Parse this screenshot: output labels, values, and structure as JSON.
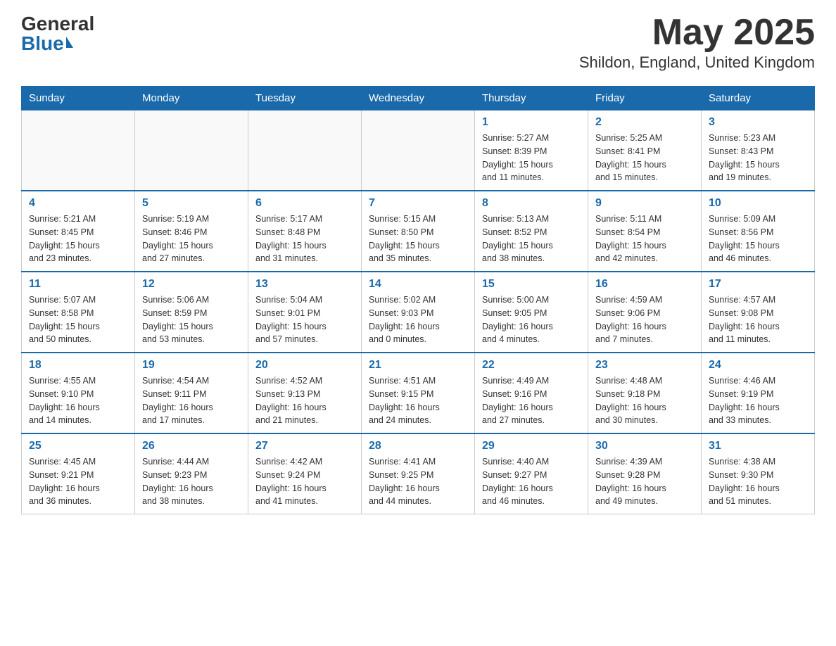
{
  "header": {
    "logo_general": "General",
    "logo_blue": "Blue",
    "month_title": "May 2025",
    "location": "Shildon, England, United Kingdom"
  },
  "days_of_week": [
    "Sunday",
    "Monday",
    "Tuesday",
    "Wednesday",
    "Thursday",
    "Friday",
    "Saturday"
  ],
  "weeks": [
    [
      {
        "day": "",
        "info": ""
      },
      {
        "day": "",
        "info": ""
      },
      {
        "day": "",
        "info": ""
      },
      {
        "day": "",
        "info": ""
      },
      {
        "day": "1",
        "info": "Sunrise: 5:27 AM\nSunset: 8:39 PM\nDaylight: 15 hours\nand 11 minutes."
      },
      {
        "day": "2",
        "info": "Sunrise: 5:25 AM\nSunset: 8:41 PM\nDaylight: 15 hours\nand 15 minutes."
      },
      {
        "day": "3",
        "info": "Sunrise: 5:23 AM\nSunset: 8:43 PM\nDaylight: 15 hours\nand 19 minutes."
      }
    ],
    [
      {
        "day": "4",
        "info": "Sunrise: 5:21 AM\nSunset: 8:45 PM\nDaylight: 15 hours\nand 23 minutes."
      },
      {
        "day": "5",
        "info": "Sunrise: 5:19 AM\nSunset: 8:46 PM\nDaylight: 15 hours\nand 27 minutes."
      },
      {
        "day": "6",
        "info": "Sunrise: 5:17 AM\nSunset: 8:48 PM\nDaylight: 15 hours\nand 31 minutes."
      },
      {
        "day": "7",
        "info": "Sunrise: 5:15 AM\nSunset: 8:50 PM\nDaylight: 15 hours\nand 35 minutes."
      },
      {
        "day": "8",
        "info": "Sunrise: 5:13 AM\nSunset: 8:52 PM\nDaylight: 15 hours\nand 38 minutes."
      },
      {
        "day": "9",
        "info": "Sunrise: 5:11 AM\nSunset: 8:54 PM\nDaylight: 15 hours\nand 42 minutes."
      },
      {
        "day": "10",
        "info": "Sunrise: 5:09 AM\nSunset: 8:56 PM\nDaylight: 15 hours\nand 46 minutes."
      }
    ],
    [
      {
        "day": "11",
        "info": "Sunrise: 5:07 AM\nSunset: 8:58 PM\nDaylight: 15 hours\nand 50 minutes."
      },
      {
        "day": "12",
        "info": "Sunrise: 5:06 AM\nSunset: 8:59 PM\nDaylight: 15 hours\nand 53 minutes."
      },
      {
        "day": "13",
        "info": "Sunrise: 5:04 AM\nSunset: 9:01 PM\nDaylight: 15 hours\nand 57 minutes."
      },
      {
        "day": "14",
        "info": "Sunrise: 5:02 AM\nSunset: 9:03 PM\nDaylight: 16 hours\nand 0 minutes."
      },
      {
        "day": "15",
        "info": "Sunrise: 5:00 AM\nSunset: 9:05 PM\nDaylight: 16 hours\nand 4 minutes."
      },
      {
        "day": "16",
        "info": "Sunrise: 4:59 AM\nSunset: 9:06 PM\nDaylight: 16 hours\nand 7 minutes."
      },
      {
        "day": "17",
        "info": "Sunrise: 4:57 AM\nSunset: 9:08 PM\nDaylight: 16 hours\nand 11 minutes."
      }
    ],
    [
      {
        "day": "18",
        "info": "Sunrise: 4:55 AM\nSunset: 9:10 PM\nDaylight: 16 hours\nand 14 minutes."
      },
      {
        "day": "19",
        "info": "Sunrise: 4:54 AM\nSunset: 9:11 PM\nDaylight: 16 hours\nand 17 minutes."
      },
      {
        "day": "20",
        "info": "Sunrise: 4:52 AM\nSunset: 9:13 PM\nDaylight: 16 hours\nand 21 minutes."
      },
      {
        "day": "21",
        "info": "Sunrise: 4:51 AM\nSunset: 9:15 PM\nDaylight: 16 hours\nand 24 minutes."
      },
      {
        "day": "22",
        "info": "Sunrise: 4:49 AM\nSunset: 9:16 PM\nDaylight: 16 hours\nand 27 minutes."
      },
      {
        "day": "23",
        "info": "Sunrise: 4:48 AM\nSunset: 9:18 PM\nDaylight: 16 hours\nand 30 minutes."
      },
      {
        "day": "24",
        "info": "Sunrise: 4:46 AM\nSunset: 9:19 PM\nDaylight: 16 hours\nand 33 minutes."
      }
    ],
    [
      {
        "day": "25",
        "info": "Sunrise: 4:45 AM\nSunset: 9:21 PM\nDaylight: 16 hours\nand 36 minutes."
      },
      {
        "day": "26",
        "info": "Sunrise: 4:44 AM\nSunset: 9:23 PM\nDaylight: 16 hours\nand 38 minutes."
      },
      {
        "day": "27",
        "info": "Sunrise: 4:42 AM\nSunset: 9:24 PM\nDaylight: 16 hours\nand 41 minutes."
      },
      {
        "day": "28",
        "info": "Sunrise: 4:41 AM\nSunset: 9:25 PM\nDaylight: 16 hours\nand 44 minutes."
      },
      {
        "day": "29",
        "info": "Sunrise: 4:40 AM\nSunset: 9:27 PM\nDaylight: 16 hours\nand 46 minutes."
      },
      {
        "day": "30",
        "info": "Sunrise: 4:39 AM\nSunset: 9:28 PM\nDaylight: 16 hours\nand 49 minutes."
      },
      {
        "day": "31",
        "info": "Sunrise: 4:38 AM\nSunset: 9:30 PM\nDaylight: 16 hours\nand 51 minutes."
      }
    ]
  ]
}
